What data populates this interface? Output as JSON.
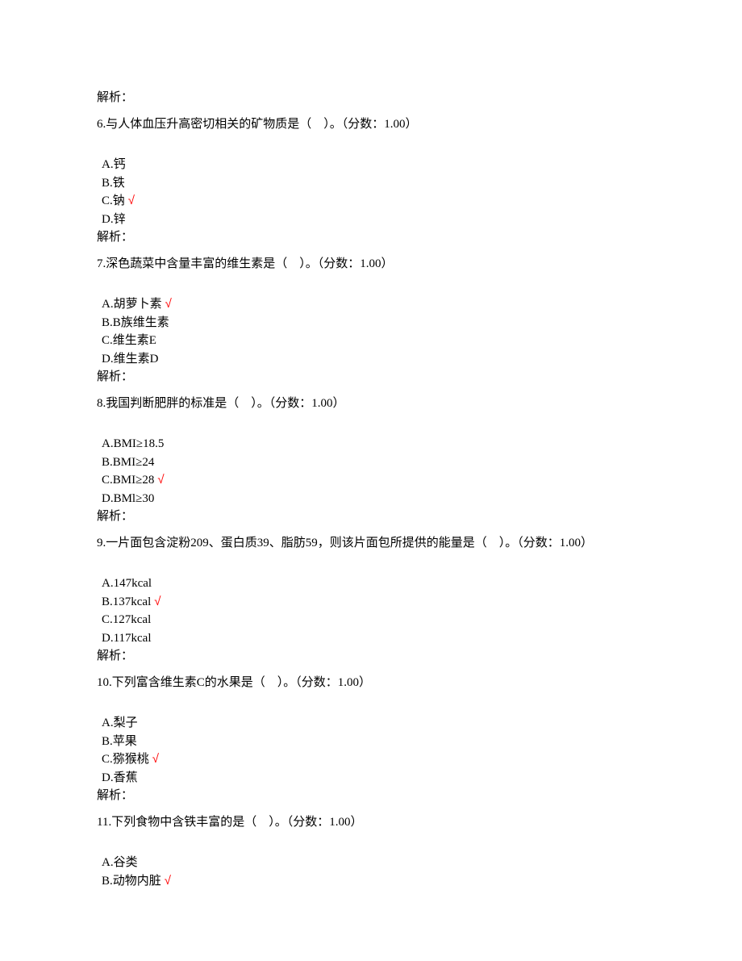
{
  "analysis_label": "解析：",
  "checkmark": "√",
  "q6": {
    "stem": "6.与人体血压升高密切相关的矿物质是（　）。（分数：1.00）",
    "opts": [
      "A.钙",
      "B.铁",
      "C.钠",
      "D.锌"
    ],
    "correct": 2
  },
  "q7": {
    "stem": "7.深色蔬菜中含量丰富的维生素是（　）。（分数：1.00）",
    "opts": [
      "A.胡萝卜素",
      "B.B族维生素",
      "C.维生素E",
      "D.维生素D"
    ],
    "correct": 0
  },
  "q8": {
    "stem": "8.我国判断肥胖的标准是（　）。（分数：1.00）",
    "opts": [
      "A.BMI≥18.5",
      "B.BMI≥24",
      "C.BMI≥28",
      "D.BMl≥30"
    ],
    "correct": 2
  },
  "q9": {
    "stem": "9.一片面包含淀粉209、蛋白质39、脂肪59，则该片面包所提供的能量是（　）。（分数：1.00）",
    "opts": [
      "A.147kcal",
      "B.137kcal",
      "C.127kcal",
      "D.117kcal"
    ],
    "correct": 1
  },
  "q10": {
    "stem": "10.下列富含维生素C的水果是（　）。（分数：1.00）",
    "opts": [
      "A.梨子",
      "B.苹果",
      "C.猕猴桃",
      "D.香蕉"
    ],
    "correct": 2
  },
  "q11": {
    "stem": "11.下列食物中含铁丰富的是（　）。（分数：1.00）",
    "opts": [
      "A.谷类",
      "B.动物内脏"
    ],
    "correct": 1
  }
}
